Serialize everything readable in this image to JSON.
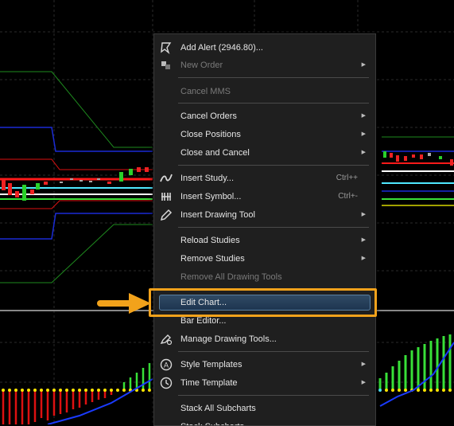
{
  "menu": {
    "items": [
      {
        "label": "Add Alert (2946.80)...",
        "icon": "alert-bell-icon",
        "disabled": false
      },
      {
        "label": "New Order",
        "icon": "order-icon",
        "disabled": true,
        "submenu": true
      },
      {
        "label": "Cancel MMS",
        "disabled": true
      },
      {
        "label": "Cancel Orders",
        "submenu": true
      },
      {
        "label": "Close Positions",
        "submenu": true
      },
      {
        "label": "Close and Cancel",
        "submenu": true
      },
      {
        "label": "Insert Study...",
        "icon": "study-icon",
        "shortcut": "Ctrl++"
      },
      {
        "label": "Insert Symbol...",
        "icon": "symbol-icon",
        "shortcut": "Ctrl+-"
      },
      {
        "label": "Insert Drawing Tool",
        "icon": "pencil-icon",
        "submenu": true
      },
      {
        "label": "Reload Studies",
        "submenu": true
      },
      {
        "label": "Remove Studies",
        "submenu": true
      },
      {
        "label": "Remove All Drawing Tools",
        "disabled": true
      },
      {
        "label": "Edit Chart...",
        "highlighted": true
      },
      {
        "label": "Bar Editor..."
      },
      {
        "label": "Manage Drawing Tools...",
        "icon": "drawing-tools-icon"
      },
      {
        "label": "Style Templates",
        "icon": "style-icon",
        "submenu": true
      },
      {
        "label": "Time Template",
        "icon": "clock-icon",
        "submenu": true
      },
      {
        "label": "Stack All Subcharts"
      },
      {
        "label": "Stack Subcharts"
      }
    ]
  },
  "colors": {
    "callout": "#f2a21b",
    "highlight": "#2f4a64",
    "menu_bg": "#1f1f1f"
  }
}
